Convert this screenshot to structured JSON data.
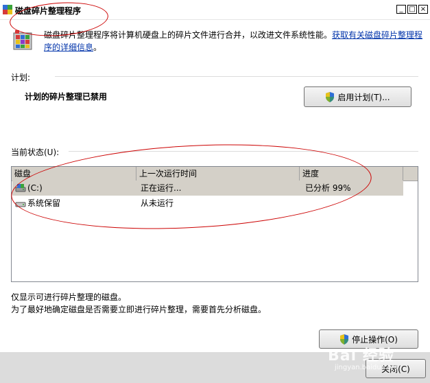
{
  "window": {
    "title": "磁盘碎片整理程序",
    "minimize_glyph": "_",
    "maximize_glyph": "□",
    "close_glyph": "×"
  },
  "description": {
    "text": "磁盘碎片整理程序将计算机硬盘上的碎片文件进行合并，以改进文件系统性能。",
    "link": "获取有关磁盘碎片整理程序的详细信息",
    "link_suffix": "。"
  },
  "schedule": {
    "label": "计划:",
    "status": "计划的碎片整理已禁用",
    "enable_button": "启用计划(T)..."
  },
  "current_status": {
    "label": "当前状态(U):",
    "columns": [
      "磁盘",
      "上一次运行时间",
      "进度"
    ],
    "rows": [
      {
        "disk": "(C:)",
        "last_run": "正在运行...",
        "progress": "已分析 99%",
        "selected": true,
        "icon": "hard-drive-icon"
      },
      {
        "disk": "系统保留",
        "last_run": "从未运行",
        "progress": "",
        "selected": false,
        "icon": "hard-drive-icon"
      }
    ]
  },
  "notes": {
    "line1": "仅显示可进行碎片整理的磁盘。",
    "line2": "为了最好地确定磁盘是否需要立即进行碎片整理，需要首先分析磁盘。"
  },
  "buttons": {
    "stop": "停止操作(O)",
    "close": "关闭(C)"
  },
  "watermark": {
    "brand": "Bai 经验",
    "url": "jingyan.baidu.com"
  },
  "colors": {
    "annotation": "#cc0000",
    "selected_row": "#d4d0c8",
    "link": "#0033aa"
  }
}
